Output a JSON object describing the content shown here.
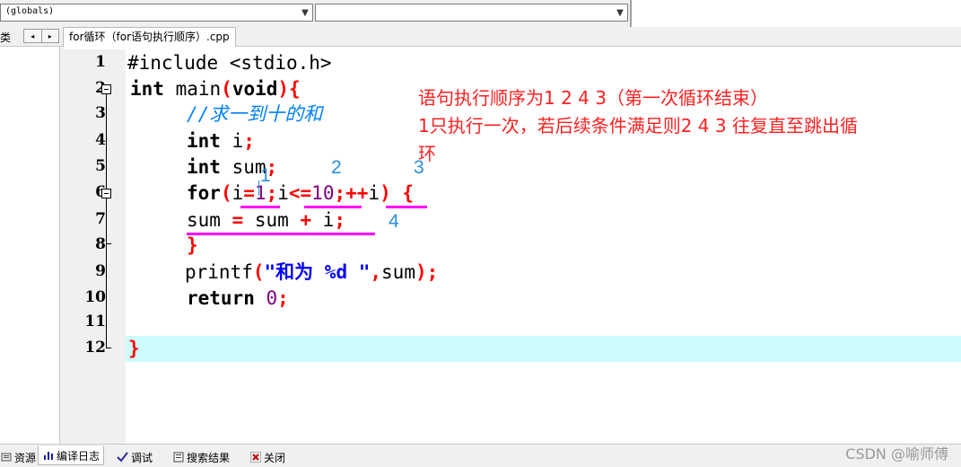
{
  "toolbar": {
    "scope_combo": "(globals)",
    "member_combo": ""
  },
  "tabs": {
    "left_panel_tab": "类",
    "nav_prev": "◂",
    "nav_next": "▸",
    "file_tab": "for循环（for语句执行顺序）.cpp"
  },
  "line_numbers": [
    "1",
    "2",
    "3",
    "4",
    "5",
    "6",
    "7",
    "8",
    "9",
    "10",
    "11",
    "12"
  ],
  "code": {
    "l1": "#include <stdio.h>",
    "l2_kw1": "int",
    "l2_name": " main",
    "l2_paren_open": "(",
    "l2_kw2": "void",
    "l2_paren_close": ")",
    "l2_brace": "{",
    "l3_comment": "//求一到十的和",
    "l4_kw": "int",
    "l4_rest": " i",
    "l4_semi": ";",
    "l5_kw": "int",
    "l5_rest": " sum",
    "l5_semi": ";",
    "l6_kw": "for",
    "l6_p1": "(",
    "l6_a": "i",
    "l6_eq": "=",
    "l6_one": "1",
    "l6_s1": ";",
    "l6_b": "i",
    "l6_le": "<=",
    "l6_ten": "10",
    "l6_s2": ";",
    "l6_pp": "++",
    "l6_c": "i",
    "l6_p2": ")",
    "l6_brace": " {",
    "l7_a": "sum ",
    "l7_eq": "=",
    "l7_b": " sum ",
    "l7_plus": "+",
    "l7_c": " i",
    "l7_semi": ";",
    "l8_brace": "}",
    "l9_fn": "printf",
    "l9_p1": "(",
    "l9_str": "\"和为 %d \"",
    "l9_comma": ",",
    "l9_arg": "sum",
    "l9_p2": ")",
    "l9_semi": ";",
    "l10_kw": "return",
    "l10_num": " 0",
    "l10_semi": ";",
    "l12_brace": "}"
  },
  "annotations": {
    "step1": "1",
    "step2": "2",
    "step3": "3",
    "step4": "4",
    "note_line1": "语句执行顺序为1 2 4 3（第一次循环结束）",
    "note_line2": "1只执行一次，若后续条件满足则2 4 3 往复直至跳出循",
    "note_line3": "环"
  },
  "bottom_tabs": [
    {
      "label": "资源",
      "icon": "resource-icon"
    },
    {
      "label": "编译日志",
      "icon": "bar-chart-icon"
    },
    {
      "label": "调试",
      "icon": "check-icon"
    },
    {
      "label": "搜索结果",
      "icon": "search-results-icon"
    },
    {
      "label": "关闭",
      "icon": "close-icon"
    }
  ],
  "watermark": "CSDN @喻师傅",
  "colors": {
    "keyword": "#000000",
    "brace": "#ff0000",
    "number": "#800080",
    "string": "#0000ff",
    "comment": "#0080ff",
    "annotation_underline": "#ff00ff",
    "annotation_number": "#2b8fdb",
    "annotation_text": "#ff2020",
    "current_line": "#ccfcfc"
  }
}
